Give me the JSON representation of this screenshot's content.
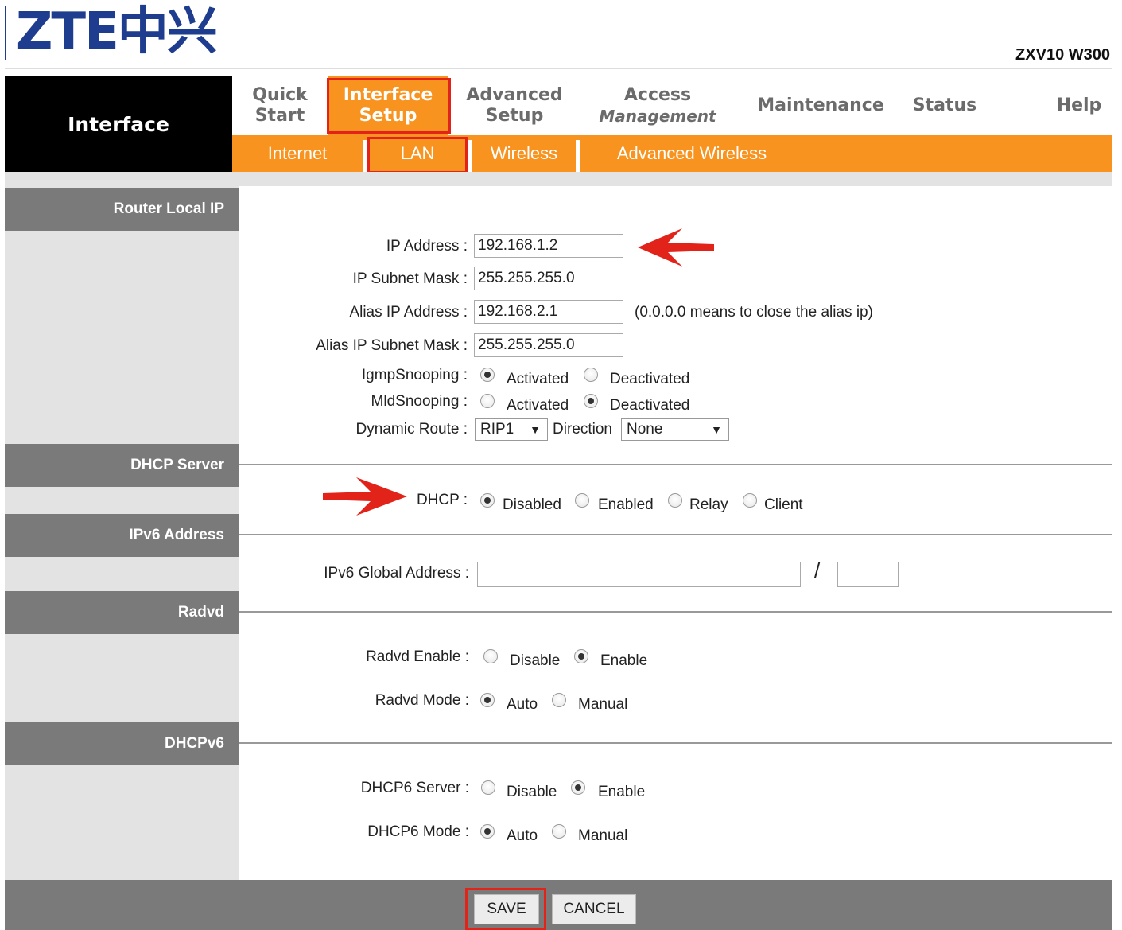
{
  "header": {
    "logo_text": "ZTE中兴",
    "model": "ZXV10 W300",
    "brand_label": "Interface"
  },
  "top_nav": [
    {
      "line1": "Quick",
      "line2": "Start"
    },
    {
      "line1": "Interface",
      "line2": "Setup",
      "active": true
    },
    {
      "line1": "Advanced",
      "line2": "Setup"
    },
    {
      "line1": "Access",
      "line2": "Management"
    },
    {
      "line1": "Maintenance",
      "line2": ""
    },
    {
      "line1": "Status",
      "line2": ""
    },
    {
      "line1": "Help",
      "line2": ""
    }
  ],
  "sub_nav": [
    "Internet",
    "LAN",
    "Wireless",
    "Advanced Wireless"
  ],
  "sections": {
    "router_local_ip": "Router Local IP",
    "dhcp_server": "DHCP Server",
    "ipv6_address": "IPv6 Address",
    "radvd": "Radvd",
    "dhcpv6": "DHCPv6"
  },
  "form": {
    "ip_address": {
      "label": "IP Address :",
      "value": "192.168.1.2"
    },
    "subnet_mask": {
      "label": "IP Subnet Mask :",
      "value": "255.255.255.0"
    },
    "alias_ip": {
      "label": "Alias IP Address :",
      "value": "192.168.2.1",
      "note": "(0.0.0.0 means to close the alias ip)"
    },
    "alias_mask": {
      "label": "Alias IP Subnet Mask :",
      "value": "255.255.255.0"
    },
    "igmp": {
      "label": "IgmpSnooping :",
      "opt1": "Activated",
      "opt2": "Deactivated",
      "selected": "Activated"
    },
    "mld": {
      "label": "MldSnooping :",
      "opt1": "Activated",
      "opt2": "Deactivated",
      "selected": "Deactivated"
    },
    "dynamic_route": {
      "label": "Dynamic Route :",
      "value": "RIP1",
      "direction_label": "Direction",
      "direction_value": "None"
    },
    "dhcp": {
      "label": "DHCP :",
      "options": [
        "Disabled",
        "Enabled",
        "Relay",
        "Client"
      ],
      "selected": "Disabled"
    },
    "ipv6_global": {
      "label": "IPv6 Global Address :",
      "value": "",
      "prefix_value": "",
      "slash": "/"
    },
    "radvd_enable": {
      "label": "Radvd Enable :",
      "opt1": "Disable",
      "opt2": "Enable",
      "selected": "Enable"
    },
    "radvd_mode": {
      "label": "Radvd Mode :",
      "opt1": "Auto",
      "opt2": "Manual",
      "selected": "Auto"
    },
    "dhcp6_server": {
      "label": "DHCP6 Server :",
      "opt1": "Disable",
      "opt2": "Enable",
      "selected": "Enable"
    },
    "dhcp6_mode": {
      "label": "DHCP6 Mode :",
      "opt1": "Auto",
      "opt2": "Manual",
      "selected": "Auto"
    }
  },
  "buttons": {
    "save": "SAVE",
    "cancel": "CANCEL"
  },
  "colors": {
    "accent": "#f7931e",
    "brand_bg": "#000000",
    "section_bg": "#7a7a7a",
    "highlight": "#e2231a",
    "logo": "#1f3d8e"
  }
}
